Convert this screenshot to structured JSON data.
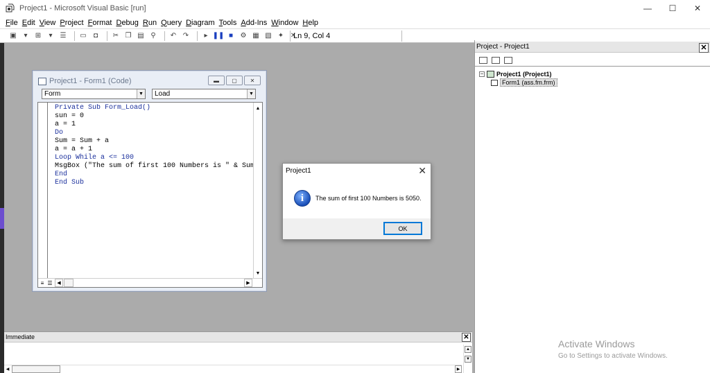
{
  "window": {
    "title": "Project1 - Microsoft Visual Basic [run]",
    "minimize": "—",
    "maximize": "☐",
    "close": "✕"
  },
  "menu": [
    "File",
    "Edit",
    "View",
    "Project",
    "Format",
    "Debug",
    "Run",
    "Query",
    "Diagram",
    "Tools",
    "Add-Ins",
    "Window",
    "Help"
  ],
  "toolbar": {
    "position": "Ln 9, Col 4"
  },
  "code_window": {
    "title": "Project1 - Form1 (Code)",
    "object_combo": "Form",
    "procedure_combo": "Load",
    "lines": [
      "Private Sub Form_Load()",
      "sun = 0",
      "a = 1",
      "Do",
      "Sum = Sum + a",
      "a = a + 1",
      "Loop While a <= 100",
      "MsgBox (\"The sum of first 100 Numbers is \" & Sum",
      "End",
      "End Sub"
    ]
  },
  "msgbox": {
    "title": "Project1",
    "message": "The sum of first 100 Numbers is 5050.",
    "ok_label": "OK",
    "icon": "info-icon"
  },
  "project_explorer": {
    "title": "Project - Project1",
    "root": "Project1 (Project1)",
    "child": "Form1 (ass.fm.frm)"
  },
  "immediate": {
    "title": "Immediate"
  },
  "watermark": {
    "line1": "Activate Windows",
    "line2": "Go to Settings to activate Windows."
  },
  "colors": {
    "keyword": "#1a2f9c",
    "workspace": "#ababab",
    "ok_border": "#0078d7"
  }
}
